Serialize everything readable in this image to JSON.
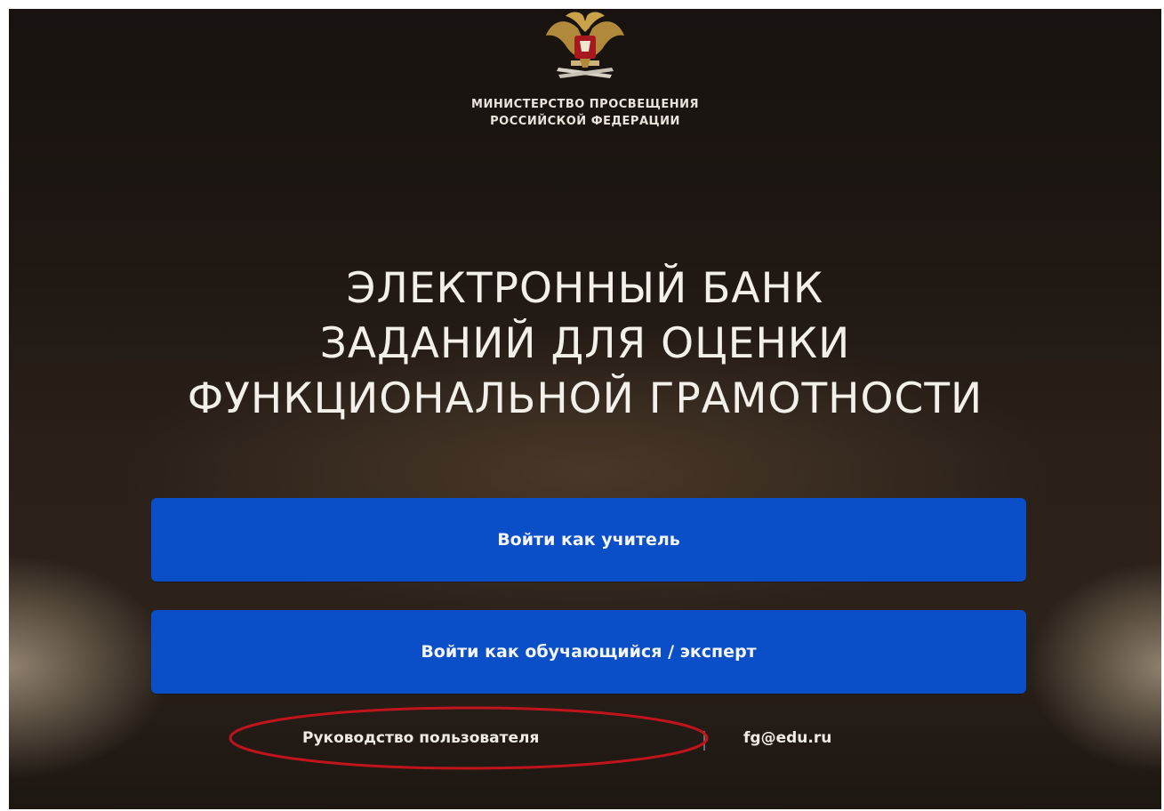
{
  "ministry": {
    "line1": "МИНИСТЕРСТВО ПРОСВЕЩЕНИЯ",
    "line2": "РОССИЙСКОЙ ФЕДЕРАЦИИ"
  },
  "title": {
    "line1": "ЭЛЕКТРОННЫЙ БАНК",
    "line2": "ЗАДАНИЙ ДЛЯ ОЦЕНКИ",
    "line3": "ФУНКЦИОНАЛЬНОЙ ГРАМОТНОСТИ"
  },
  "buttons": {
    "teacher": "Войти как учитель",
    "student": "Войти как обучающийся / эксперт"
  },
  "footer": {
    "guide": "Руководство пользователя",
    "email": "fg@edu.ru"
  },
  "icons": {
    "emblem": "russian-coat-of-arms-icon"
  },
  "colors": {
    "button": "#0a4fc8",
    "highlight": "#c0141c",
    "text": "#f3f0ea"
  }
}
